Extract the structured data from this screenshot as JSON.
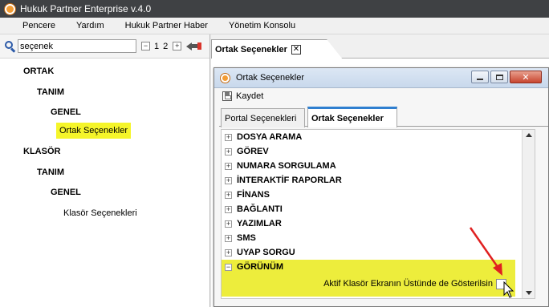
{
  "app": {
    "title": "Hukuk Partner Enterprise v.4.0"
  },
  "menu": {
    "items": [
      "Pencere",
      "Yardım",
      "Hukuk Partner Haber",
      "Yönetim Konsolu"
    ]
  },
  "search": {
    "value": "seçenek",
    "collapse_glyph": "−",
    "expand_glyph": "+",
    "page_1": "1",
    "page_2": "2"
  },
  "tree": {
    "items": [
      {
        "label": "ORTAK"
      },
      {
        "label": "TANIM"
      },
      {
        "label": "GENEL"
      },
      {
        "label": "Ortak Seçenekler"
      },
      {
        "label": "KLASÖR"
      },
      {
        "label": "TANIM"
      },
      {
        "label": "GENEL"
      },
      {
        "label": "Klasör Seçenekleri"
      }
    ]
  },
  "tabs": {
    "main_label": "Ortak Seçenekler",
    "close_glyph": "✕"
  },
  "dialog": {
    "title": "Ortak Seçenekler",
    "close_glyph": "✕",
    "save_label": "Kaydet",
    "tabs": [
      "Portal Seçenekleri",
      "Ortak Seçenekler"
    ],
    "sections": [
      {
        "label": "DOSYA ARAMA",
        "glyph": "+"
      },
      {
        "label": "GÖREV",
        "glyph": "+"
      },
      {
        "label": "NUMARA SORGULAMA",
        "glyph": "+"
      },
      {
        "label": "İNTERAKTİF RAPORLAR",
        "glyph": "+"
      },
      {
        "label": "FİNANS",
        "glyph": "+"
      },
      {
        "label": "BAĞLANTI",
        "glyph": "+"
      },
      {
        "label": "YAZIMLAR",
        "glyph": "+"
      },
      {
        "label": "SMS",
        "glyph": "+"
      },
      {
        "label": "UYAP SORGU",
        "glyph": "+"
      },
      {
        "label": "GÖRÜNÜM",
        "glyph": "−"
      }
    ],
    "setting": {
      "label": "Aktif Klasör Ekranın Üstünde de Gösterilsin",
      "checked": false
    }
  },
  "colors": {
    "highlight": "#f5f52a",
    "section_highlight": "#eded3c",
    "accent": "#2f7fd0",
    "annotation": "#e02020"
  }
}
